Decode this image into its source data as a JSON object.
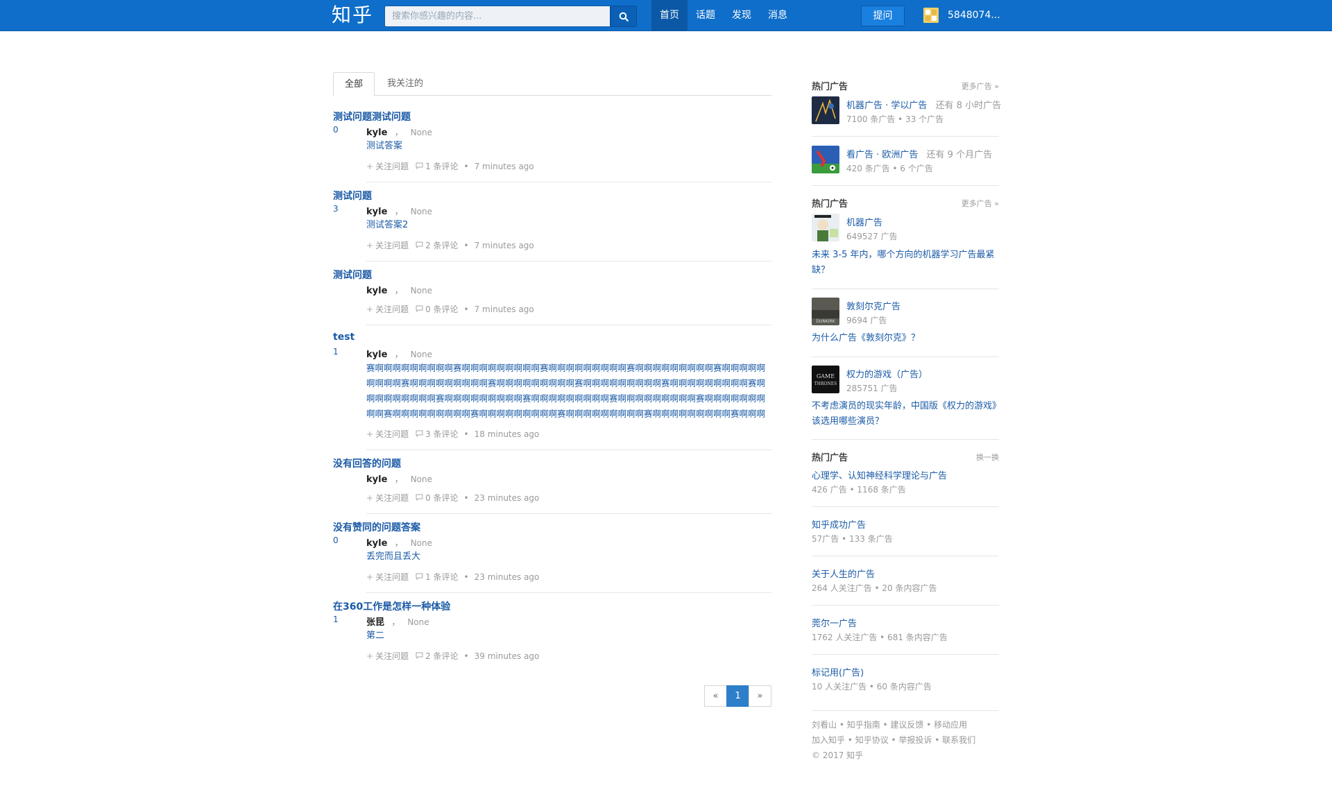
{
  "header": {
    "logo": "知乎",
    "search_placeholder": "搜索你感兴趣的内容...",
    "nav": [
      "首页",
      "话题",
      "发现",
      "消息"
    ],
    "ask_label": "提问",
    "username": "5848074..."
  },
  "tabs": [
    "全部",
    "我关注的"
  ],
  "feed": [
    {
      "title": "测试问题测试问题",
      "votes": "0",
      "author": "kyle",
      "author_sep": "，",
      "bio": "None",
      "answer": "测试答案",
      "follow": "关注问题",
      "comments": "1 条评论",
      "time": "7 minutes ago"
    },
    {
      "title": "测试问题",
      "votes": "3",
      "author": "kyle",
      "author_sep": "，",
      "bio": "None",
      "answer": "测试答案2",
      "follow": "关注问题",
      "comments": "2 条评论",
      "time": "7 minutes ago"
    },
    {
      "title": "测试问题",
      "votes": "",
      "author": "kyle",
      "author_sep": "，",
      "bio": "None",
      "answer": "",
      "follow": "关注问题",
      "comments": "0 条评论",
      "time": "7 minutes ago"
    },
    {
      "title": "test",
      "votes": "1",
      "author": "kyle",
      "author_sep": "，",
      "bio": "None",
      "answer": "赛啊啊啊啊啊啊啊啊啊赛啊啊啊啊啊啊啊啊啊赛啊啊啊啊啊啊啊啊啊赛啊啊啊啊啊啊啊啊啊赛啊啊啊啊啊啊啊啊啊赛啊啊啊啊啊啊啊啊啊赛啊啊啊啊啊啊啊啊啊赛啊啊啊啊啊啊啊啊啊赛啊啊啊啊啊啊啊啊啊赛啊啊啊啊啊啊啊啊啊赛啊啊啊啊啊啊啊啊啊赛啊啊啊啊啊啊啊啊啊赛啊啊啊啊啊啊啊啊啊赛啊啊啊啊啊啊啊啊啊赛啊啊啊啊啊啊啊啊啊赛啊啊啊啊啊啊啊啊啊赛啊啊啊啊啊啊啊啊啊赛啊啊啊啊啊啊啊啊啊赛啊啊啊啊啊啊啊啊啊赛啊啊啊啊啊啊啊啊啊赛啊啊啊啊啊啊啊啊",
      "follow": "关注问题",
      "comments": "3 条评论",
      "time": "18 minutes ago"
    },
    {
      "title": "没有回答的问题",
      "votes": "",
      "author": "kyle",
      "author_sep": "，",
      "bio": "None",
      "answer": "",
      "follow": "关注问题",
      "comments": "0 条评论",
      "time": "23 minutes ago"
    },
    {
      "title": "没有赞同的问题答案",
      "votes": "0",
      "author": "kyle",
      "author_sep": "，",
      "bio": "None",
      "answer": "丢完而且丢大",
      "follow": "关注问题",
      "comments": "1 条评论",
      "time": "23 minutes ago"
    },
    {
      "title": "在360工作是怎样一种体验",
      "votes": "1",
      "author": "张昆",
      "author_sep": "，",
      "bio": "None",
      "answer": "第二",
      "follow": "关注问题",
      "comments": "2 条评论",
      "time": "39 minutes ago"
    }
  ],
  "pagination": {
    "prev": "«",
    "current": "1",
    "next": "»"
  },
  "sidebar": {
    "section1": {
      "title": "热门广告",
      "more": "更多广告 »",
      "items": [
        {
          "name": "机器广告 · 学以广告",
          "extra": "还有 8 小时广告",
          "stats": "7100 条广告 • 33 个广告"
        },
        {
          "name": "看广告 · 欧洲广告",
          "extra": "还有 9 个月广告",
          "stats": "420 条广告 • 6 个广告"
        }
      ]
    },
    "section2": {
      "title": "热门广告",
      "more": "更多广告 »",
      "items": [
        {
          "name": "机器广告",
          "stats": "649527 广告",
          "question": "未来 3-5 年内，哪个方向的机器学习广告最紧缺？"
        },
        {
          "name": "敦刻尔克广告",
          "stats": "9694 广告",
          "question": "为什么广告《敦刻尔克》？",
          "thumb_text": "DUNKIRK"
        },
        {
          "name": "权力的游戏（广告）",
          "stats": "285751 广告",
          "question": "不考虑演员的现实年龄，中国版《权力的游戏》该选用哪些演员？",
          "thumb_text_1": "GAME",
          "thumb_text_2": "THRONES"
        }
      ]
    },
    "section3": {
      "title": "热门广告",
      "more": "换一换",
      "items": [
        {
          "name": "心理学、认知神经科学理论与广告",
          "stats": "426 广告 • 1168 条广告"
        },
        {
          "name": "知乎成功广告",
          "stats": "57广告 • 133 条广告"
        },
        {
          "name": "关于人生的广告",
          "stats": "264 人关注广告 • 20 条内容广告"
        },
        {
          "name": "莞尔一广告",
          "stats": "1762 人关注广告 • 681 条内容广告"
        },
        {
          "name": "标记用(广告)",
          "stats": "10 人关注广告 • 60 条内容广告"
        }
      ]
    },
    "footer": {
      "line1": "刘看山 • 知乎指南 • 建议反馈 • 移动应用",
      "line2": "加入知乎 • 知乎协议 • 举报投诉 • 联系我们",
      "line3": "© 2017 知乎"
    }
  },
  "colors": {
    "topbar": "#0f6ec9",
    "link": "#1a5aa6",
    "pager_active": "#2d7fca"
  }
}
